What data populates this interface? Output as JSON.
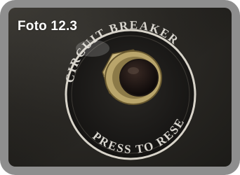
{
  "caption": "Foto 12.3",
  "breaker": {
    "top_text": "CIRCUIT BREAKER",
    "bottom_text": "PRESS TO RESET"
  },
  "colors": {
    "frame": "#8e8e8e",
    "panel": "#2b2925",
    "label_plate": "#1a1917",
    "lettering": "#d9d6cf",
    "brass": "#c9b57a"
  }
}
